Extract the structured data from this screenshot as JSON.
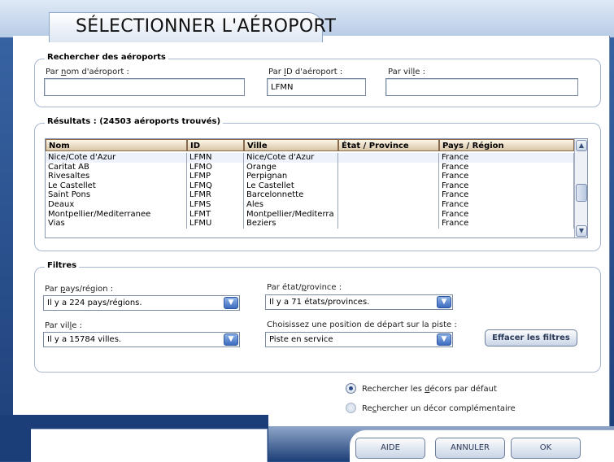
{
  "title": "SÉLECTIONNER L'AÉROPORT",
  "search": {
    "group_title": "Rechercher des aéroports",
    "by_name_label": [
      "Par ",
      "n",
      "om d'aéroport :"
    ],
    "by_name_value": "",
    "by_id_label": [
      "Par ",
      "I",
      "D d'aéroport :"
    ],
    "by_id_value": "LFMN",
    "by_city_label": [
      "Par vil",
      "l",
      "e :"
    ],
    "by_city_value": ""
  },
  "results": {
    "group_title": "Résultats : (24503 aéroports trouvés)",
    "columns": [
      "Nom",
      "ID",
      "Ville",
      "État / Province",
      "Pays / Région"
    ],
    "rows": [
      [
        "Nice/Cote d'Azur",
        "LFMN",
        "Nice/Cote d'Azur",
        "",
        "France"
      ],
      [
        "Caritat AB",
        "LFMO",
        "Orange",
        "",
        "France"
      ],
      [
        "Rivesaltes",
        "LFMP",
        "Perpignan",
        "",
        "France"
      ],
      [
        "Le Castellet",
        "LFMQ",
        "Le Castellet",
        "",
        "France"
      ],
      [
        "Saint Pons",
        "LFMR",
        "Barcelonnette",
        "",
        "France"
      ],
      [
        "Deaux",
        "LFMS",
        "Ales",
        "",
        "France"
      ],
      [
        "Montpellier/Mediterranee",
        "LFMT",
        "Montpellier/Mediterra",
        "",
        "France"
      ],
      [
        "Vias",
        "LFMU",
        "Beziers",
        "",
        "France"
      ]
    ]
  },
  "filters": {
    "group_title": "Filtres",
    "country_label": [
      "Par ",
      "p",
      "ays/région :"
    ],
    "country_value": "Il y a 224 pays/régions.",
    "state_label": [
      "Par état/",
      "p",
      "rovince :"
    ],
    "state_value": "Il y a 71 états/provinces.",
    "city_label": [
      "Par vil",
      "l",
      "e :"
    ],
    "city_value": "Il y a 15784 villes.",
    "runway_label": "Choisissez une position de départ sur la piste :",
    "runway_value": "Piste en service",
    "clear_button": "Effacer les filtres"
  },
  "scenery": {
    "default_label": [
      "Rechercher les ",
      "d",
      "écors par défaut"
    ],
    "addon_label": [
      "Re",
      "c",
      "hercher un décor complémentaire"
    ],
    "default_selected": true
  },
  "buttons": {
    "help": "AIDE",
    "cancel": "ANNULER",
    "ok": "OK"
  },
  "colors": {
    "frame": "#2a4f86",
    "header_cell": "#eadcc4",
    "combo_arrow": "#3d6cc0"
  }
}
